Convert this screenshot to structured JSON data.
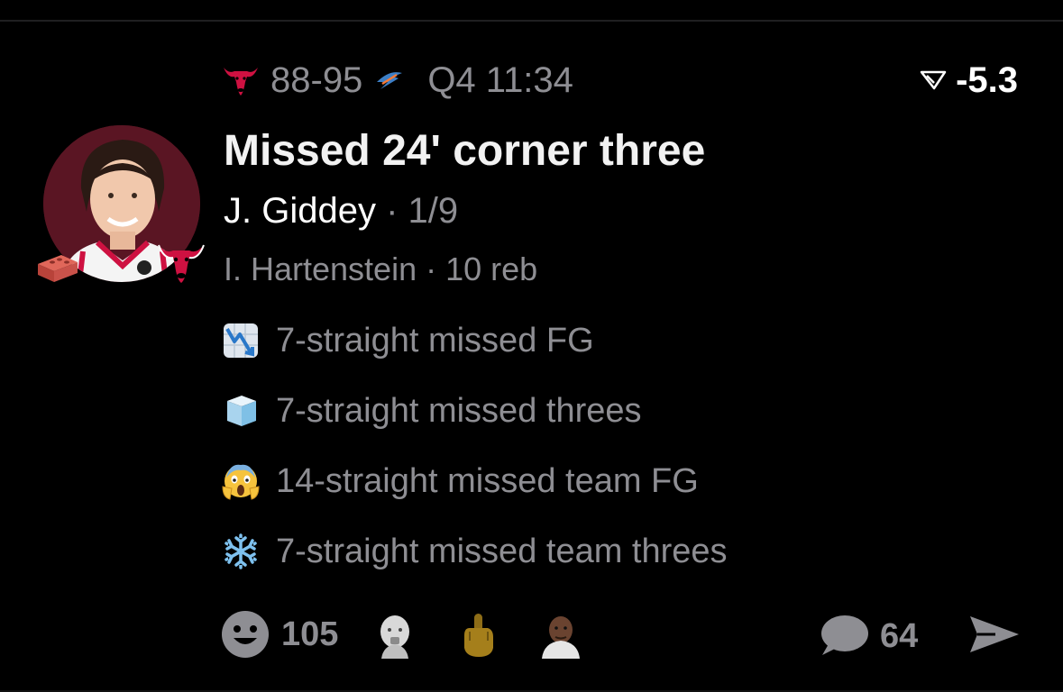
{
  "scoreline": {
    "home_team_logo": "chicago-bulls-logo",
    "score": "88-95",
    "away_team_logo": "okc-thunder-logo",
    "clock": "Q4 11:34"
  },
  "spread": {
    "icon": "sharp-spread-icon",
    "value": "-5.3"
  },
  "play": {
    "headline": "Missed 24' corner three",
    "player_name": "J. Giddey",
    "player_stat": " · 1/9",
    "assist_line": "I. Hartenstein · 10 reb"
  },
  "avatar": {
    "badge_emoji": "brick",
    "team_badge": "chicago-bulls-logo"
  },
  "facts": [
    {
      "icon": "chart-decreasing-icon",
      "text": "7-straight missed FG"
    },
    {
      "icon": "ice-cube-icon",
      "text": "7-straight missed threes"
    },
    {
      "icon": "screaming-face-icon",
      "text": "14-straight missed team FG"
    },
    {
      "icon": "snowflake-icon",
      "text": "7-straight missed team threes"
    }
  ],
  "reactions": {
    "count": "105",
    "avatars": [
      "baby-face-reaction",
      "middle-finger-reaction",
      "man-face-reaction"
    ]
  },
  "comments": {
    "count": "64"
  },
  "colors": {
    "background": "#000000",
    "muted": "#8e8e93",
    "bulls_red": "#ce1141",
    "avatar_bg": "#5a1523"
  }
}
